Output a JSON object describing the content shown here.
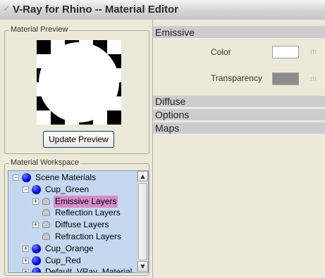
{
  "window": {
    "title": "V-Ray for Rhino -- Material Editor",
    "title_icon": "vray-icon"
  },
  "preview": {
    "group_label": "Material Preview",
    "update_button": "Update Preview",
    "background": "checkerboard",
    "sphere_color": "#ffffff"
  },
  "workspace": {
    "group_label": "Material Workspace",
    "tree": [
      {
        "label": "Scene Materials",
        "level": 0,
        "expander": "-",
        "icon": "material-ball-icon"
      },
      {
        "label": "Cup_Green",
        "level": 1,
        "expander": "-",
        "icon": "material-ball-icon"
      },
      {
        "label": "Emissive Layers",
        "level": 2,
        "expander": "+",
        "icon": "layer-icon",
        "selected": true
      },
      {
        "label": "Reflection Layers",
        "level": 2,
        "expander": "",
        "icon": "layer-icon"
      },
      {
        "label": "Diffuse Layers",
        "level": 2,
        "expander": "+",
        "icon": "layer-icon"
      },
      {
        "label": "Refraction Layers",
        "level": 2,
        "expander": "",
        "icon": "layer-icon"
      },
      {
        "label": "Cup_Orange",
        "level": 1,
        "expander": "+",
        "icon": "material-ball-icon"
      },
      {
        "label": "Cup_Red",
        "level": 1,
        "expander": "+",
        "icon": "material-ball-icon"
      },
      {
        "label": "Default_VRay_Material",
        "level": 1,
        "expander": "+",
        "icon": "material-ball-icon"
      }
    ],
    "selection_color": "#d88bc9"
  },
  "emissive": {
    "header": "Emissive",
    "color_label": "Color",
    "color_value": "#ffffff",
    "color_map_label": "m",
    "transparency_label": "Transparency",
    "transparency_value": "#8c8c8c",
    "transparency_map_label": "m"
  },
  "sections": [
    "Diffuse",
    "Options",
    "Maps"
  ]
}
